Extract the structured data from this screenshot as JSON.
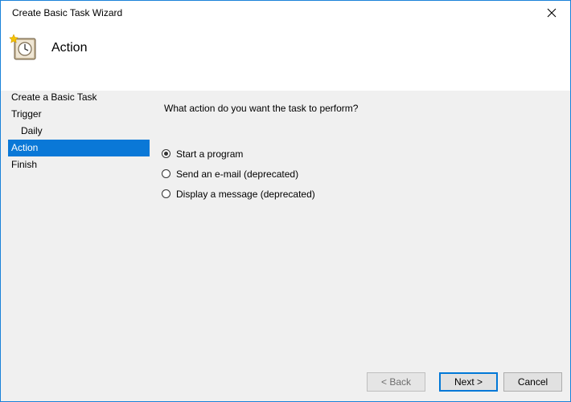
{
  "window": {
    "title": "Create Basic Task Wizard"
  },
  "header": {
    "title": "Action",
    "icon": "task-scheduler-icon"
  },
  "sidebar": {
    "items": [
      {
        "label": "Create a Basic Task",
        "indent": false,
        "selected": false
      },
      {
        "label": "Trigger",
        "indent": false,
        "selected": false
      },
      {
        "label": "Daily",
        "indent": true,
        "selected": false
      },
      {
        "label": "Action",
        "indent": false,
        "selected": true
      },
      {
        "label": "Finish",
        "indent": false,
        "selected": false
      }
    ]
  },
  "main": {
    "question": "What action do you want the task to perform?",
    "options": [
      {
        "label": "Start a program",
        "checked": true
      },
      {
        "label": "Send an e-mail (deprecated)",
        "checked": false
      },
      {
        "label": "Display a message (deprecated)",
        "checked": false
      }
    ]
  },
  "buttons": {
    "back": "< Back",
    "next": "Next >",
    "cancel": "Cancel"
  },
  "colors": {
    "accent": "#0a78d7"
  }
}
